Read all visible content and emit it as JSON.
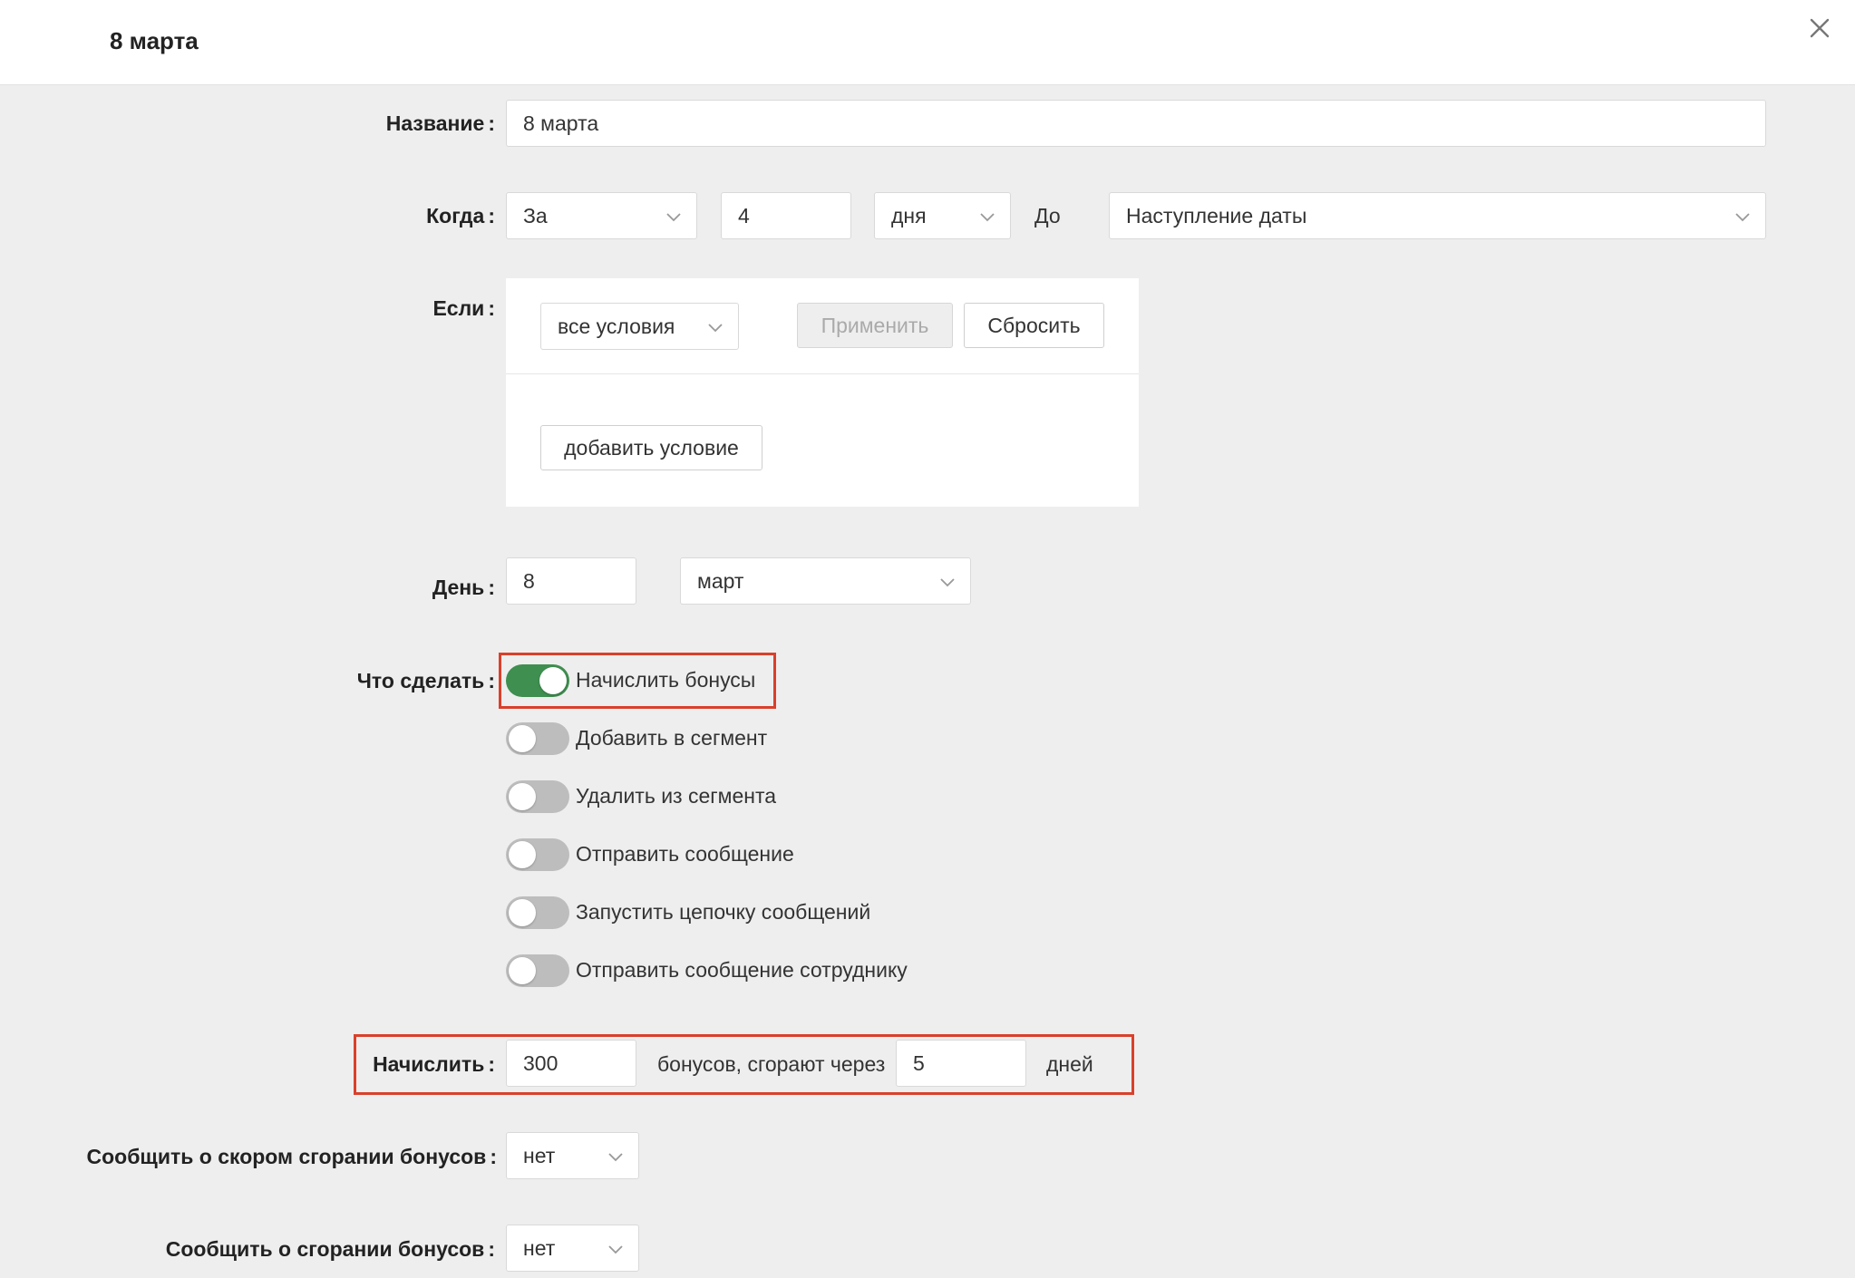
{
  "header": {
    "title": "8 марта"
  },
  "name_field": {
    "label": "Название",
    "value": "8 марта"
  },
  "when": {
    "label": "Когда",
    "relation": "За",
    "amount": "4",
    "unit": "дня",
    "until_label": "До",
    "event": "Наступление даты"
  },
  "conditions": {
    "label": "Если",
    "mode": "все условия",
    "apply_label": "Применить",
    "reset_label": "Сбросить",
    "add_label": "добавить условие"
  },
  "day": {
    "label": "День",
    "day_value": "8",
    "month_value": "март"
  },
  "actions": {
    "label": "Что сделать",
    "items": [
      {
        "label": "Начислить бонусы",
        "on": true
      },
      {
        "label": "Добавить в сегмент",
        "on": false
      },
      {
        "label": "Удалить из сегмента",
        "on": false
      },
      {
        "label": "Отправить сообщение",
        "on": false
      },
      {
        "label": "Запустить цепочку сообщений",
        "on": false
      },
      {
        "label": "Отправить сообщение сотруднику",
        "on": false
      }
    ]
  },
  "accrue": {
    "label": "Начислить",
    "amount": "300",
    "middle_text": "бонусов, сгорают через",
    "days": "5",
    "suffix": "дней"
  },
  "notify_soon": {
    "label": "Сообщить о скором сгорании бонусов",
    "value": "нет"
  },
  "notify_burn": {
    "label": "Сообщить о сгорании бонусов",
    "value": "нет"
  },
  "colors": {
    "toggle_on": "#3f8f50",
    "toggle_off": "#bdbdbd",
    "highlight": "#d9402b"
  }
}
